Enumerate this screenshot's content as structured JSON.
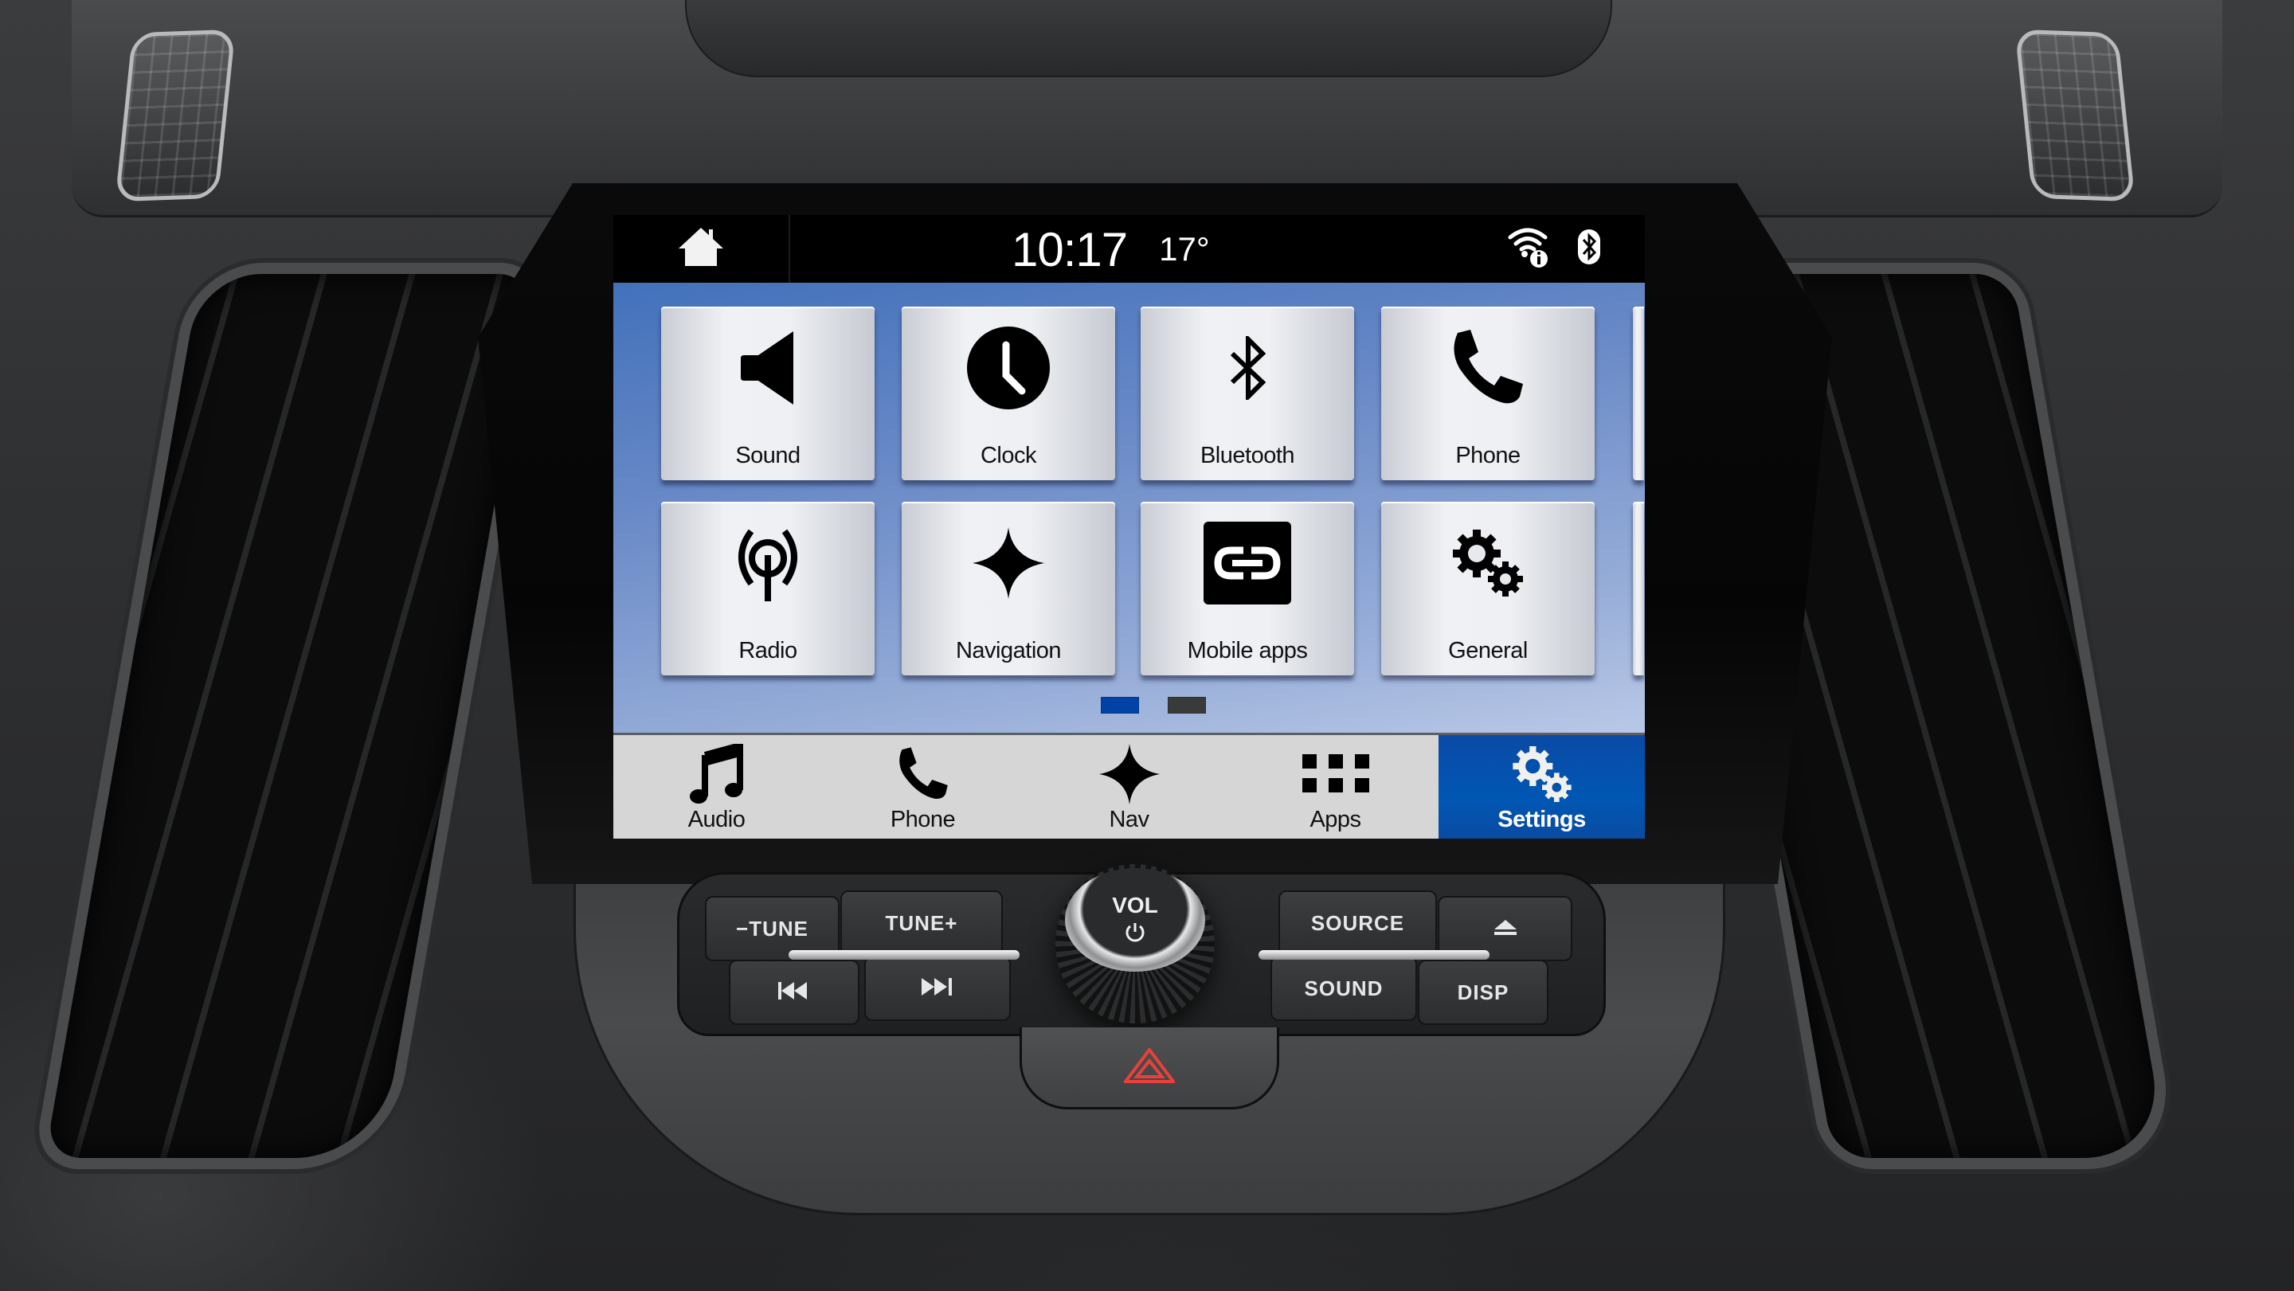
{
  "status_bar": {
    "time": "10:17",
    "temperature": "17°",
    "icons": [
      "home-icon",
      "wifi-info-icon",
      "bluetooth-icon"
    ]
  },
  "settings_grid": {
    "tiles": [
      {
        "label": "Sound",
        "icon": "speaker-icon"
      },
      {
        "label": "Clock",
        "icon": "clock-icon"
      },
      {
        "label": "Bluetooth",
        "icon": "bluetooth-icon"
      },
      {
        "label": "Phone",
        "icon": "phone-handset-icon"
      },
      {
        "label": "Radio",
        "icon": "radio-antenna-icon"
      },
      {
        "label": "Navigation",
        "icon": "nav-star-icon"
      },
      {
        "label": "Mobile apps",
        "icon": "link-apps-icon"
      },
      {
        "label": "General",
        "icon": "gears-icon"
      }
    ],
    "pager": {
      "pages": 2,
      "current": 1
    },
    "colors": {
      "pager_active": "#0043a5",
      "pager_inactive": "#3a3a3a"
    }
  },
  "bottom_nav": {
    "tabs": [
      {
        "label": "Audio",
        "icon": "music-note-icon",
        "active": false
      },
      {
        "label": "Phone",
        "icon": "phone-handset-icon",
        "active": false
      },
      {
        "label": "Nav",
        "icon": "nav-star-icon",
        "active": false
      },
      {
        "label": "Apps",
        "icon": "apps-grid-icon",
        "active": false
      },
      {
        "label": "Settings",
        "icon": "gears-icon",
        "active": true
      }
    ],
    "colors": {
      "active_bg": "#0051ad",
      "bar_bg": "#d6d6d6"
    }
  },
  "hardware_controls": {
    "tune_down": "−TUNE",
    "tune_up": "TUNE+",
    "seek_back_icon": "seek-back-icon",
    "seek_forward_icon": "seek-forward-icon",
    "volume_knob": "VOL",
    "power_icon": "power-icon",
    "source": "SOURCE",
    "eject_icon": "eject-icon",
    "sound": "SOUND",
    "display": "DISP",
    "hazard_icon": "hazard-triangle-icon",
    "hazard_color": "#e8413c"
  }
}
